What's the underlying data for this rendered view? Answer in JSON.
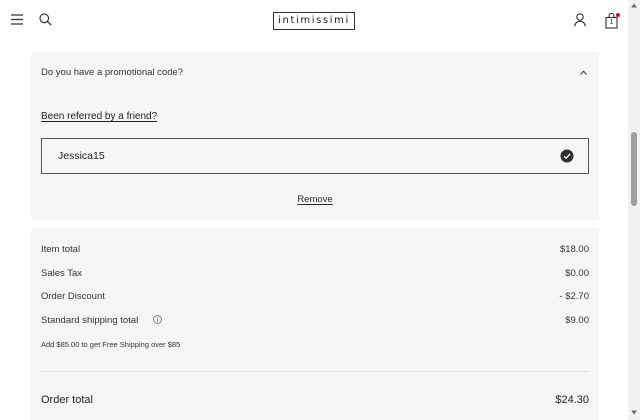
{
  "header": {
    "logo_text": "intimissimi",
    "icons": [
      "menu-icon",
      "search-icon",
      "user-icon",
      "shopping-bag-icon"
    ],
    "cart_count": "1",
    "accent_color": "#c8102e"
  },
  "promo": {
    "question": "Do you have a promotional code?",
    "referred_link": "Been referred by a friend?",
    "code_value": "Jessica15",
    "remove_label": "Remove"
  },
  "summary": {
    "rows": [
      {
        "label": "Item total",
        "value": "$18.00"
      },
      {
        "label": "Sales Tax",
        "value": "$0.00"
      },
      {
        "label": "Order Discount",
        "value": "- $2.70"
      },
      {
        "label": "Standard shipping total",
        "value": "$9.00"
      }
    ],
    "shipping_note": "Add $85.00 to get Free Shipping over $85",
    "order_total_label": "Order total",
    "order_total_value": "$24.30"
  }
}
